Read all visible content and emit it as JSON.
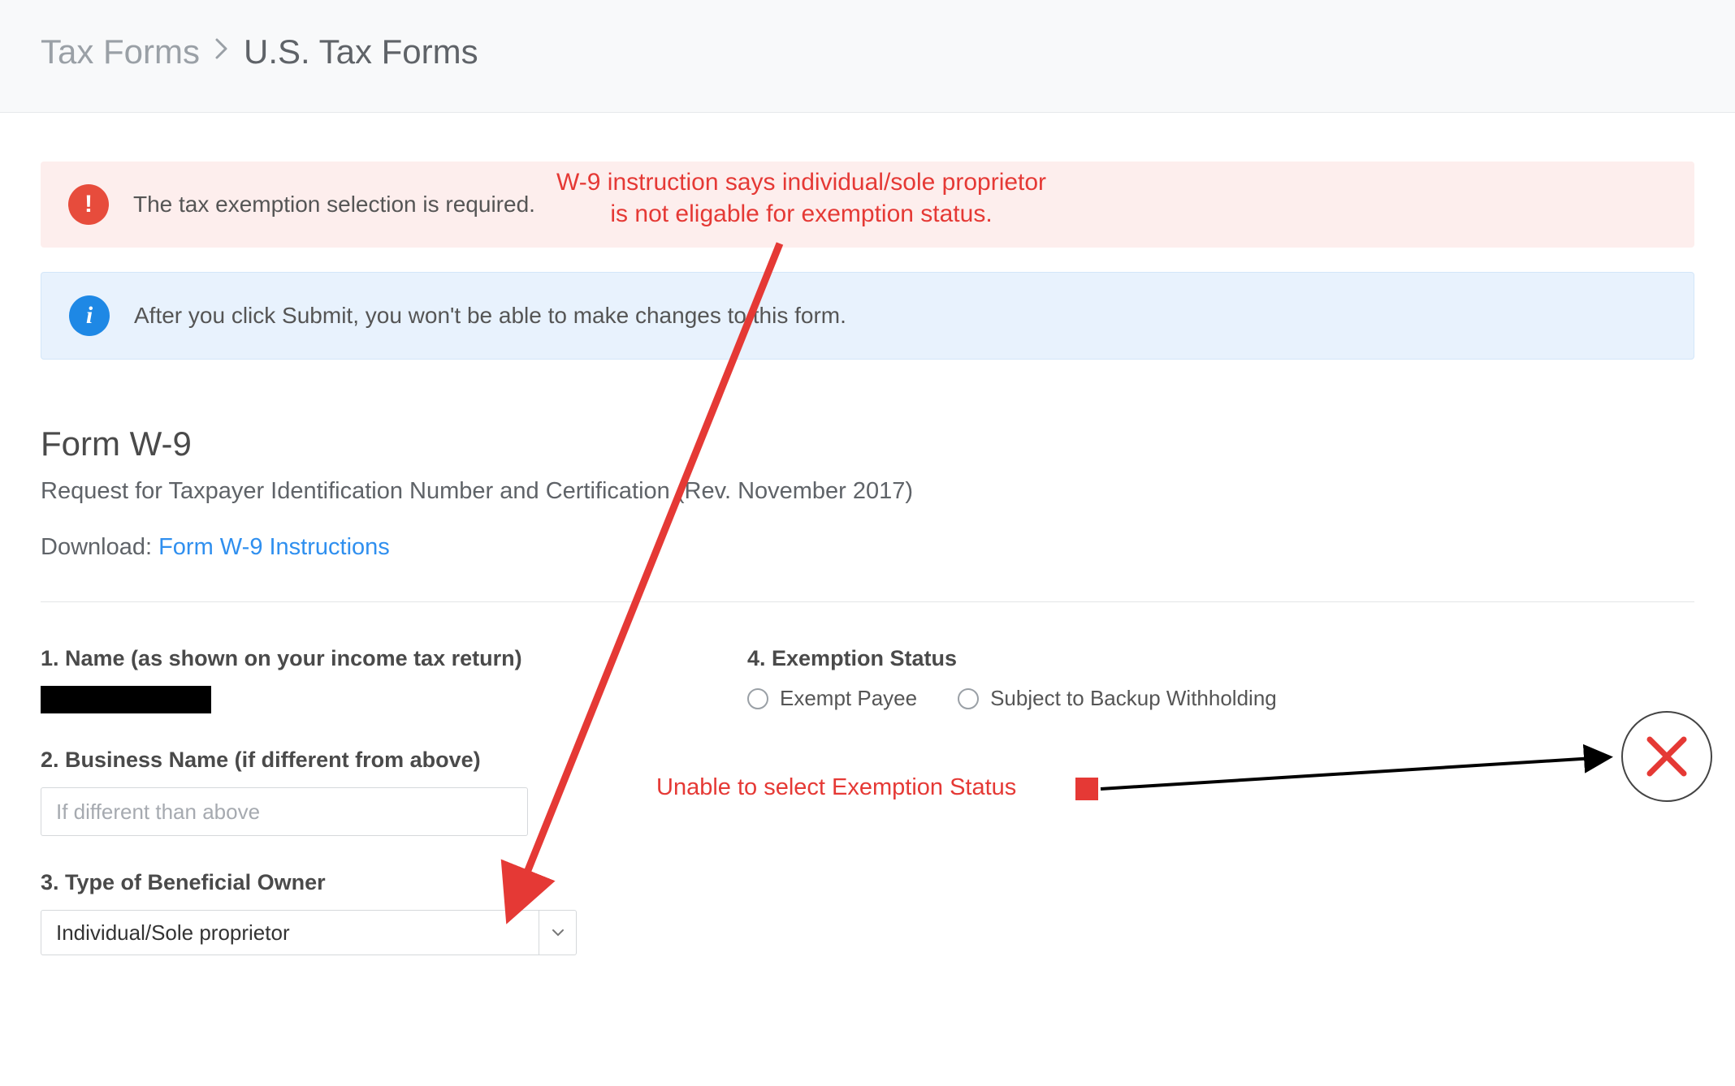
{
  "breadcrumb": {
    "root": "Tax Forms",
    "current": "U.S. Tax Forms"
  },
  "alerts": {
    "error": "The tax exemption selection is required.",
    "info": "After you click Submit, you won't be able to make changes to this form."
  },
  "form": {
    "title": "Form W-9",
    "subtitle": "Request for Taxpayer Identification Number and Certification (Rev. November 2017)",
    "download_label": "Download: ",
    "download_link": "Form W-9 Instructions"
  },
  "fields": {
    "name_label": "1. Name (as shown on your income tax return)",
    "business_label": "2. Business Name (if different from above)",
    "business_placeholder": "If different than above",
    "owner_type_label": "3. Type of Beneficial Owner",
    "owner_type_value": "Individual/Sole proprietor",
    "exemption_label": "4. Exemption Status",
    "exemption_opt1": "Exempt Payee",
    "exemption_opt2": "Subject to Backup Withholding"
  },
  "annotations": {
    "top_line1": "W-9 instruction says individual/sole proprietor",
    "top_line2": "is not eligable for exemption status.",
    "mid": "Unable to select Exemption Status"
  }
}
